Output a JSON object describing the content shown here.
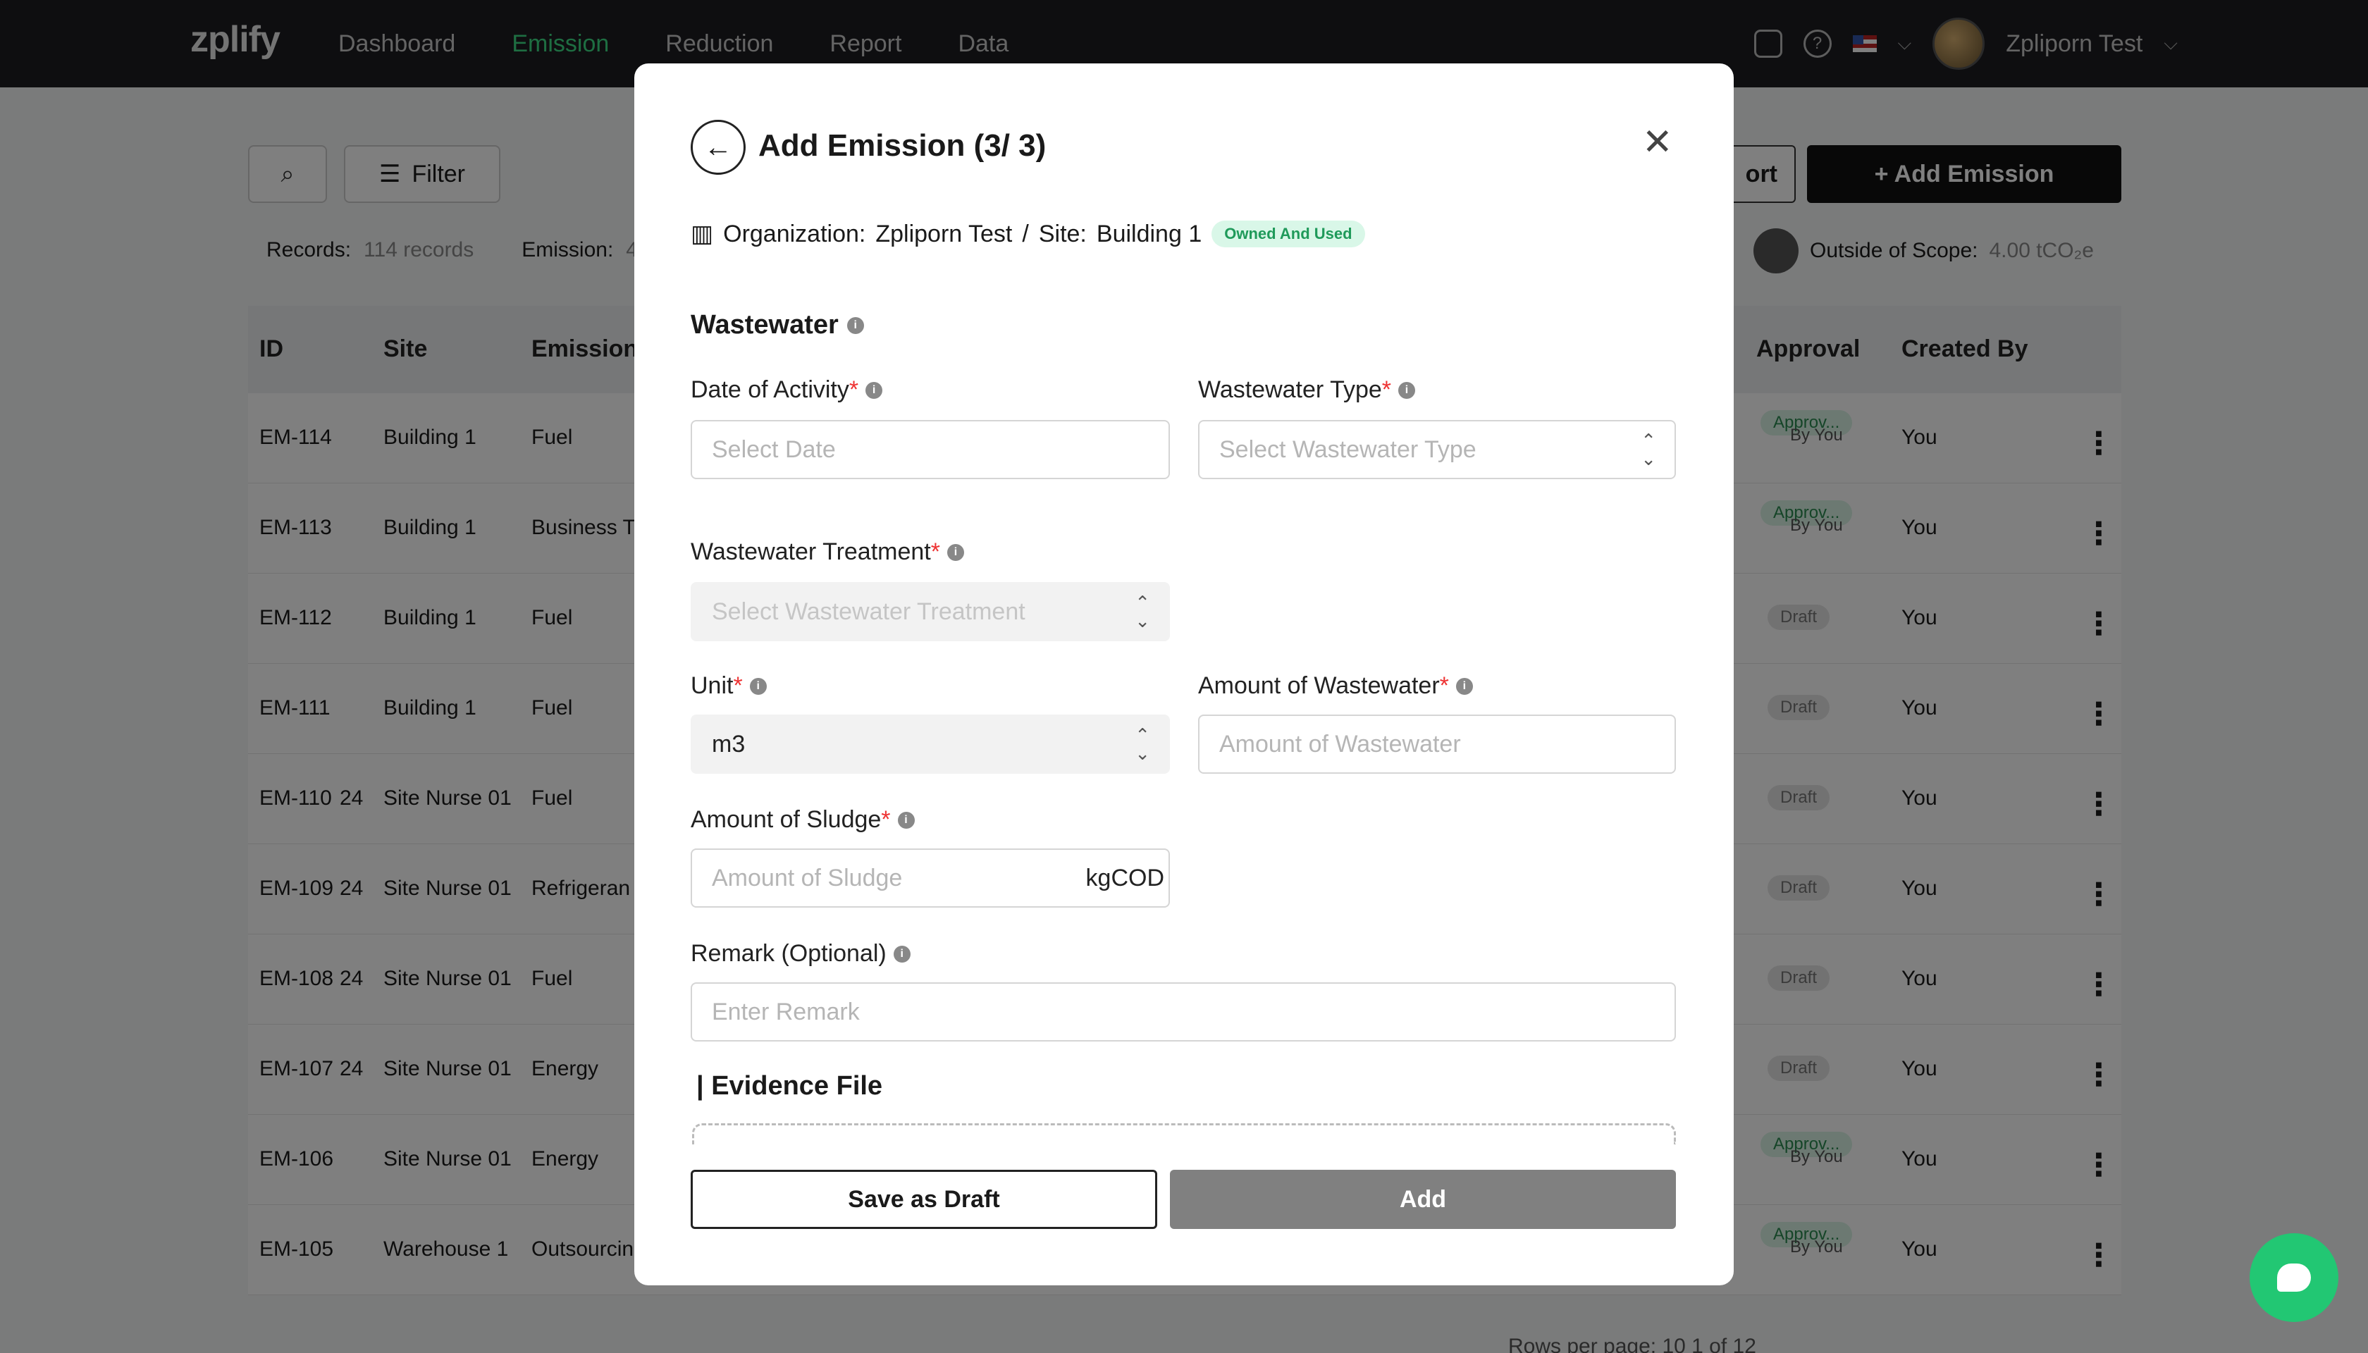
{
  "nav": {
    "logo": "zplify",
    "links": [
      "Dashboard",
      "Emission",
      "Reduction",
      "Report",
      "Data"
    ],
    "active": "Emission",
    "username": "Zpliporn Test"
  },
  "toolbar": {
    "filter_label": "Filter",
    "export_label": "ort",
    "add_label": "+ Add Emission"
  },
  "stats": {
    "records_label": "Records:",
    "records_value": "114 records",
    "emission_label": "Emission:",
    "emission_value": "4",
    "outside_label": "Outside of Scope:",
    "outside_value": "4.00 tCO₂e"
  },
  "table": {
    "headers": {
      "id": "ID",
      "site": "Site",
      "emission": "Emission",
      "approval": "Approval",
      "created_by": "Created By"
    },
    "rows": [
      {
        "id": "EM-114",
        "extra": "",
        "site": "Building 1",
        "emission": "Fuel",
        "status": "Approv...",
        "by": "By You",
        "created": "You"
      },
      {
        "id": "EM-113",
        "extra": "",
        "site": "Building 1",
        "emission": "Business T",
        "status": "Approv...",
        "by": "By You",
        "created": "You"
      },
      {
        "id": "EM-112",
        "extra": "",
        "site": "Building 1",
        "emission": "Fuel",
        "status": "Draft",
        "by": "",
        "created": "You"
      },
      {
        "id": "EM-111",
        "extra": "",
        "site": "Building 1",
        "emission": "Fuel",
        "status": "Draft",
        "by": "",
        "created": "You"
      },
      {
        "id": "EM-110",
        "extra": "24",
        "site": "Site Nurse 01",
        "emission": "Fuel",
        "status": "Draft",
        "by": "",
        "created": "You"
      },
      {
        "id": "EM-109",
        "extra": "24",
        "site": "Site Nurse 01",
        "emission": "Refrigeran",
        "status": "Draft",
        "by": "",
        "created": "You"
      },
      {
        "id": "EM-108",
        "extra": "24",
        "site": "Site Nurse 01",
        "emission": "Fuel",
        "status": "Draft",
        "by": "",
        "created": "You"
      },
      {
        "id": "EM-107",
        "extra": "24",
        "site": "Site Nurse 01",
        "emission": "Energy",
        "status": "Draft",
        "by": "",
        "created": "You"
      },
      {
        "id": "EM-106",
        "extra": "",
        "site": "Site Nurse 01",
        "emission": "Energy",
        "status": "Approv...",
        "by": "By You",
        "created": "You"
      },
      {
        "id": "EM-105",
        "extra": "",
        "site": "Warehouse 1",
        "emission": "Outsourcin",
        "status": "Approv...",
        "by": "By You",
        "created": "You"
      }
    ],
    "pager": "Rows per page:  10      1 of 12"
  },
  "modal": {
    "title": "Add Emission (3/ 3)",
    "org_label": "Organization:",
    "org_value": "Zpliporn Test",
    "separator": "/",
    "site_label": "Site:",
    "site_value": "Building 1",
    "ownership_badge": "Owned And Used",
    "section_title": "Wastewater",
    "fields": {
      "date": {
        "label": "Date of Activity",
        "placeholder": "Select Date"
      },
      "type": {
        "label": "Wastewater Type",
        "placeholder": "Select Wastewater Type"
      },
      "treatment": {
        "label": "Wastewater Treatment",
        "placeholder": "Select Wastewater Treatment"
      },
      "unit": {
        "label": "Unit",
        "value": "m3"
      },
      "amount": {
        "label": "Amount of Wastewater",
        "placeholder": "Amount of Wastewater"
      },
      "sludge": {
        "label": "Amount of Sludge",
        "placeholder": "Amount of Sludge",
        "suffix": "kgCOD"
      },
      "remark": {
        "label": "Remark (Optional)",
        "placeholder": "Enter Remark"
      }
    },
    "evidence_title": "| Evidence File",
    "save_draft_label": "Save as Draft",
    "add_label": "Add"
  },
  "colors": {
    "accent": "#3ddc84",
    "chat": "#22c773",
    "required": "#ee3333"
  },
  "icons": [
    "search-icon",
    "filter-icon",
    "info-icon",
    "back-arrow-icon",
    "close-icon",
    "building-icon",
    "chat-icon"
  ]
}
